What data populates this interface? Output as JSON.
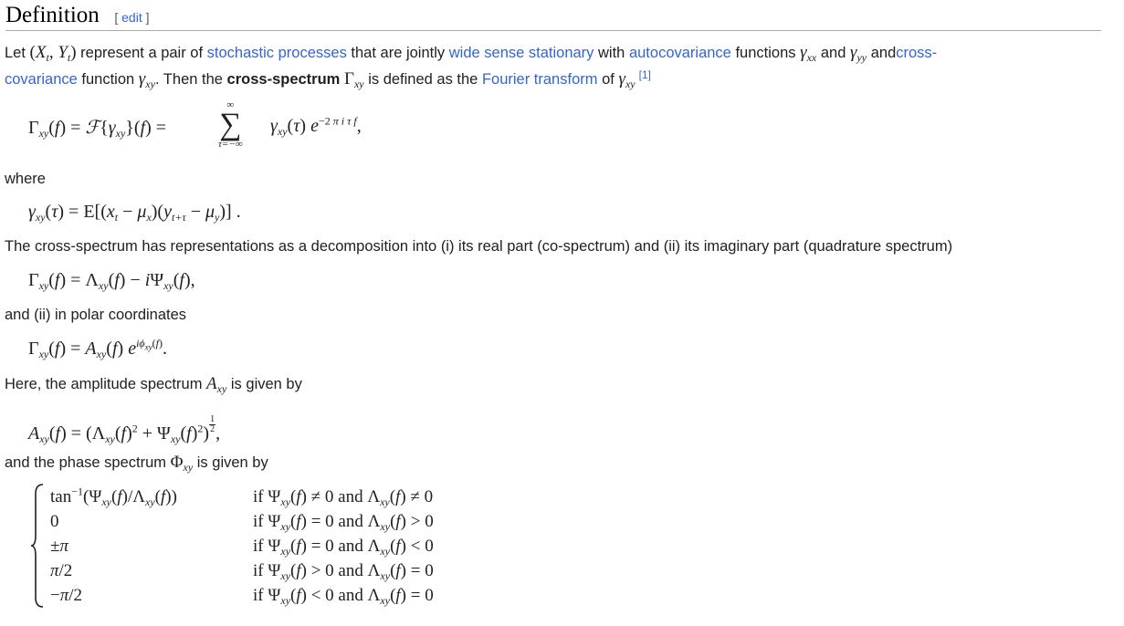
{
  "section": {
    "title": "Definition",
    "edit_label": "edit"
  },
  "intro": {
    "let": "Let",
    "pair_text": "represent a pair of",
    "link_stochastic": "stochastic processes",
    "jointly_text": "that are jointly",
    "link_wss": "wide sense stationary",
    "with_text": "with",
    "link_autocov": "autocovariance",
    "functions_text": "functions",
    "and_text": "and",
    "link_crosscov_1": "cross-",
    "link_crosscov_2": "covariance",
    "function_text": "function",
    "then_text": ". Then the",
    "bold_term": "cross-spectrum",
    "defined_text": "is defined as the",
    "link_fourier": "Fourier transform",
    "of_text": "of",
    "ref": "[1]"
  },
  "where_label": "where",
  "representation_text": "The cross-spectrum has representations as a decomposition into (i) its real part (co-spectrum) and (ii) its imaginary part (quadrature spectrum)",
  "polar_text": "and (ii) in polar coordinates",
  "amplitude_text_1": "Here, the amplitude spectrum",
  "amplitude_text_2": "is given by",
  "phase_text_1": "and the phase spectrum",
  "phase_text_2": "is given by",
  "cases_conditions_and": "and",
  "cases_if": "if"
}
